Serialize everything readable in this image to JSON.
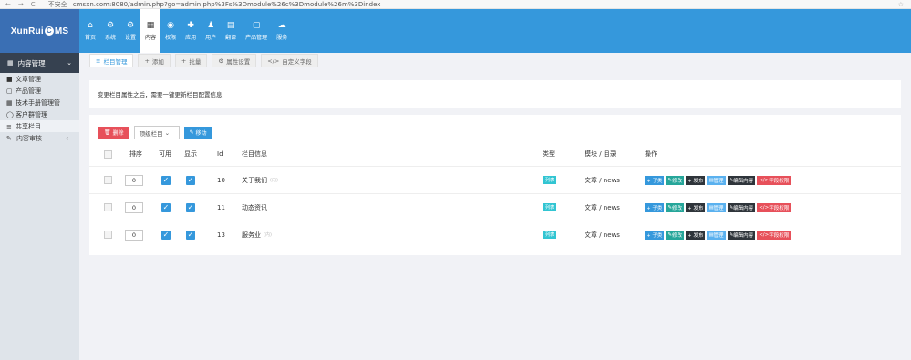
{
  "browser": {
    "nav_back": "←",
    "nav_forward": "→",
    "nav_reload": "C",
    "security_label": "不安全",
    "url": "cmsxn.com:8080/admin.php?go=admin.php%3Fs%3Dmodule%26c%3Dmodule%26m%3Dindex"
  },
  "logo": {
    "prefix": "XunRui",
    "c": "C",
    "suffix": "MS"
  },
  "topmenu": [
    {
      "icon": "home-icon",
      "glyph": "⌂",
      "label": "首页"
    },
    {
      "icon": "system-icon",
      "glyph": "⚙",
      "label": "系统"
    },
    {
      "icon": "settings-icon",
      "glyph": "⚙",
      "label": "设置"
    },
    {
      "icon": "content-icon",
      "glyph": "▦",
      "label": "内容"
    },
    {
      "icon": "permission-icon",
      "glyph": "◉",
      "label": "权限"
    },
    {
      "icon": "apps-icon",
      "glyph": "✚",
      "label": "应用"
    },
    {
      "icon": "user-icon",
      "glyph": "♟",
      "label": "用户"
    },
    {
      "icon": "translate-icon",
      "glyph": "▤",
      "label": "翻译"
    },
    {
      "icon": "product-icon",
      "glyph": "▢",
      "label": "产品管理"
    },
    {
      "icon": "cloud-icon",
      "glyph": "☁",
      "label": "服务"
    }
  ],
  "sidebar": {
    "head": "内容管理",
    "items": [
      {
        "glyph": "■",
        "label": "文章管理"
      },
      {
        "glyph": "▢",
        "label": "产品管理"
      },
      {
        "glyph": "▦",
        "label": "技术手册管理管"
      },
      {
        "glyph": "◯",
        "label": "客户群管理"
      },
      {
        "glyph": "≡",
        "label": "共享栏目"
      }
    ],
    "group": {
      "glyph": "✎",
      "label": "内容审核",
      "chev": "‹"
    }
  },
  "tabs": [
    {
      "glyph": "≡",
      "label": "栏目管理"
    },
    {
      "glyph": "+",
      "label": "添加"
    },
    {
      "glyph": "+",
      "label": "批量"
    },
    {
      "glyph": "⚙",
      "label": "属性设置"
    },
    {
      "glyph": "</>",
      "label": "自定义字段"
    }
  ],
  "info_text": "变更栏目属性之后，需要一键更新栏目配置信息",
  "toolbar": {
    "delete_label": "删除",
    "select_value": "顶级栏目",
    "move_label": "移动"
  },
  "columns": {
    "order": "排序",
    "enabled": "可用",
    "visible": "显示",
    "id": "Id",
    "info": "栏目信息",
    "type": "类型",
    "module": "模块 / 目录",
    "actions": "操作"
  },
  "rows": [
    {
      "order": "0",
      "id": "10",
      "name": "关于我们",
      "sub": "(内)",
      "type": "列表",
      "module": "文章 / news"
    },
    {
      "order": "0",
      "id": "11",
      "name": "动态资讯",
      "sub": "",
      "type": "列表",
      "module": "文章 / news"
    },
    {
      "order": "0",
      "id": "13",
      "name": "服务业",
      "sub": "(内)",
      "type": "列表",
      "module": "文章 / news"
    }
  ],
  "actions": {
    "add_child": "+ 子类",
    "edit": "修改",
    "publish": "+ 发布",
    "manage": "管理",
    "edit_content": "编辑内容",
    "field_perm": "字段权限"
  },
  "colors": {
    "header_blue": "#3598dc",
    "logo_bg": "#3a6fb4",
    "sidebar_dark": "#364150",
    "danger": "#e7505a",
    "tag_cyan": "#32c5d2"
  }
}
